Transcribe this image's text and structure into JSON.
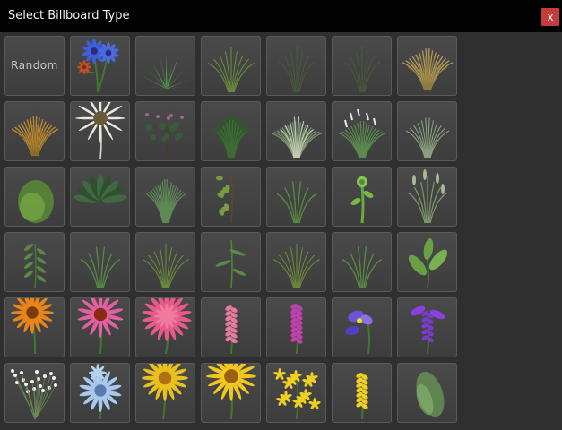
{
  "window": {
    "title": "Select Billboard Type",
    "close_label": "x"
  },
  "grid": {
    "columns": 7,
    "selected_index": 47,
    "tiles": [
      {
        "kind": "random",
        "label": "Random",
        "icon": "random-icon"
      },
      {
        "kind": "cornflower",
        "icon": "blue-cornflower-icon"
      },
      {
        "kind": "agave",
        "icon": "agave-icon"
      },
      {
        "kind": "grass-sparse",
        "icon": "sparse-grass-icon"
      },
      {
        "kind": "grass-thin-dark",
        "icon": "thin-grass-icon"
      },
      {
        "kind": "grass-thin-dark",
        "icon": "thin-grass-icon"
      },
      {
        "kind": "grass-tan-plume",
        "icon": "tan-plume-grass-icon"
      },
      {
        "kind": "grass-orange-tuft",
        "icon": "orange-grass-tuft-icon"
      },
      {
        "kind": "white-star-flower",
        "icon": "white-star-flower-icon"
      },
      {
        "kind": "shrub-pink",
        "icon": "flowering-shrub-icon"
      },
      {
        "kind": "bush-dark",
        "icon": "dark-grass-bush-icon"
      },
      {
        "kind": "fountain-grass",
        "icon": "fountain-grass-icon"
      },
      {
        "kind": "white-tips-grass",
        "icon": "white-tipped-grass-icon"
      },
      {
        "kind": "grass-pale",
        "icon": "pale-grass-icon"
      },
      {
        "kind": "blurry-shrub",
        "icon": "blurred-shrub-icon"
      },
      {
        "kind": "fern-dark",
        "icon": "fern-icon"
      },
      {
        "kind": "grass-tall-green",
        "icon": "tall-grass-icon"
      },
      {
        "kind": "sapling",
        "icon": "sapling-icon"
      },
      {
        "kind": "weed-thin",
        "icon": "weed-icon"
      },
      {
        "kind": "fiddlehead",
        "icon": "fiddlehead-icon"
      },
      {
        "kind": "grain-grass",
        "icon": "grain-grass-icon"
      },
      {
        "kind": "weed-leafy",
        "icon": "leafy-weed-icon"
      },
      {
        "kind": "weed-thin",
        "icon": "weed-icon"
      },
      {
        "kind": "grass-sparse",
        "icon": "sparse-grass-icon"
      },
      {
        "kind": "weed-tall",
        "icon": "tall-weed-icon"
      },
      {
        "kind": "grass-sparse",
        "icon": "sparse-grass-icon"
      },
      {
        "kind": "weed-thin",
        "icon": "weed-icon"
      },
      {
        "kind": "broad-leaf",
        "icon": "broad-leaf-plant-icon"
      },
      {
        "kind": "orange-daisy",
        "icon": "orange-daisy-icon"
      },
      {
        "kind": "coneflower",
        "icon": "coneflower-icon"
      },
      {
        "kind": "zinnia",
        "icon": "zinnia-icon"
      },
      {
        "kind": "snapdragon",
        "icon": "snapdragon-icon"
      },
      {
        "kind": "purple-spike",
        "icon": "purple-spike-flower-icon"
      },
      {
        "kind": "iris",
        "icon": "iris-icon"
      },
      {
        "kind": "purple-spike-2",
        "icon": "purple-salvia-icon"
      },
      {
        "kind": "babys-breath",
        "icon": "babys-breath-icon"
      },
      {
        "kind": "chicory",
        "icon": "chicory-icon"
      },
      {
        "kind": "yellow-daisy",
        "icon": "yellow-daisy-icon"
      },
      {
        "kind": "yellow-daisy-2",
        "icon": "yellow-daisy-icon"
      },
      {
        "kind": "yellow-cluster",
        "icon": "yellow-flower-cluster-icon"
      },
      {
        "kind": "yellow-spike-selected",
        "icon": "yellow-spike-flower-icon"
      },
      {
        "kind": "blurry-grass",
        "icon": "blurred-grass-icon"
      }
    ]
  },
  "colors": {
    "titlebar": "#020202",
    "close_button": "#c63b3b",
    "tile_background": "#454545",
    "selected_tile": "#6fe86a"
  }
}
